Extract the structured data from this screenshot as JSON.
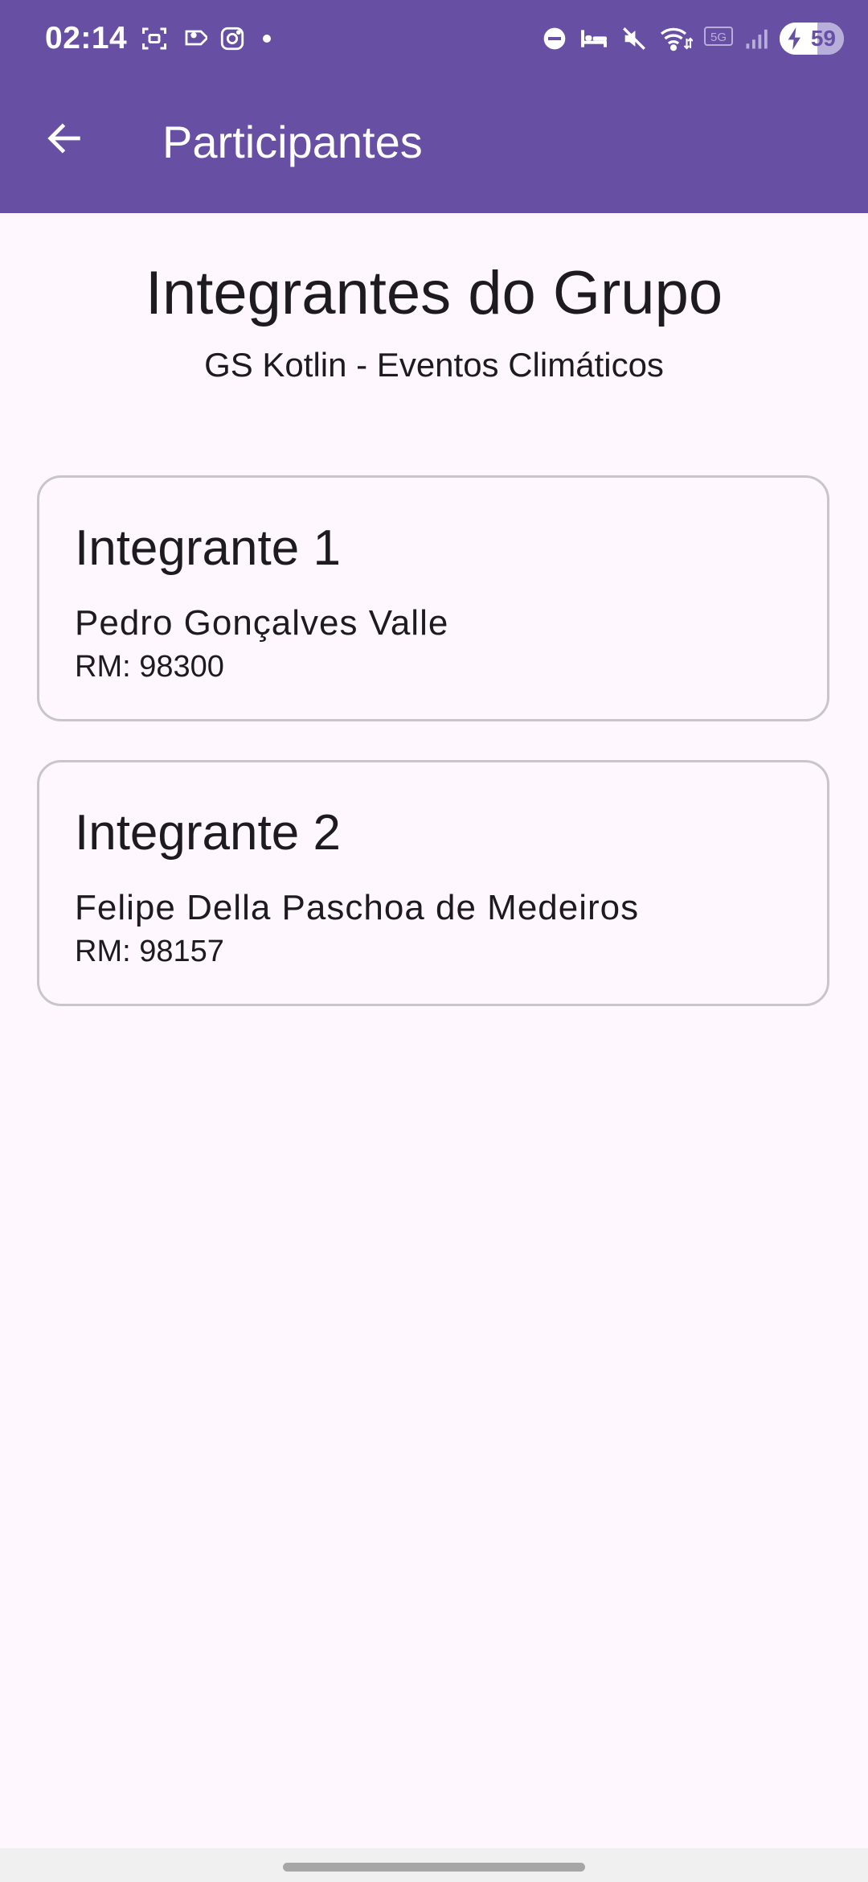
{
  "status_bar": {
    "time": "02:14",
    "battery_level": "59",
    "network_label": "5G",
    "left_icons": [
      "screenshot-icon",
      "tag-icon",
      "instagram-icon",
      "dot-icon"
    ],
    "right_icons": [
      "dnd-icon",
      "bed-icon",
      "mute-icon",
      "wifi-icon",
      "5g-icon",
      "signal-icon",
      "battery-icon"
    ]
  },
  "app_bar": {
    "title": "Participantes",
    "back_icon": "arrow-back-icon"
  },
  "header": {
    "title": "Integrantes do Grupo",
    "subtitle": "GS Kotlin - Eventos Climáticos"
  },
  "members": [
    {
      "title": "Integrante 1",
      "name": "Pedro Gonçalves Valle",
      "rm": "RM: 98300"
    },
    {
      "title": "Integrante 2",
      "name": "Felipe Della Paschoa de Medeiros",
      "rm": "RM: 98157"
    }
  ],
  "colors": {
    "primary": "#6750A4",
    "background": "#FEF7FD",
    "on_surface": "#1D1B20",
    "outline": "#C9C5CC"
  }
}
